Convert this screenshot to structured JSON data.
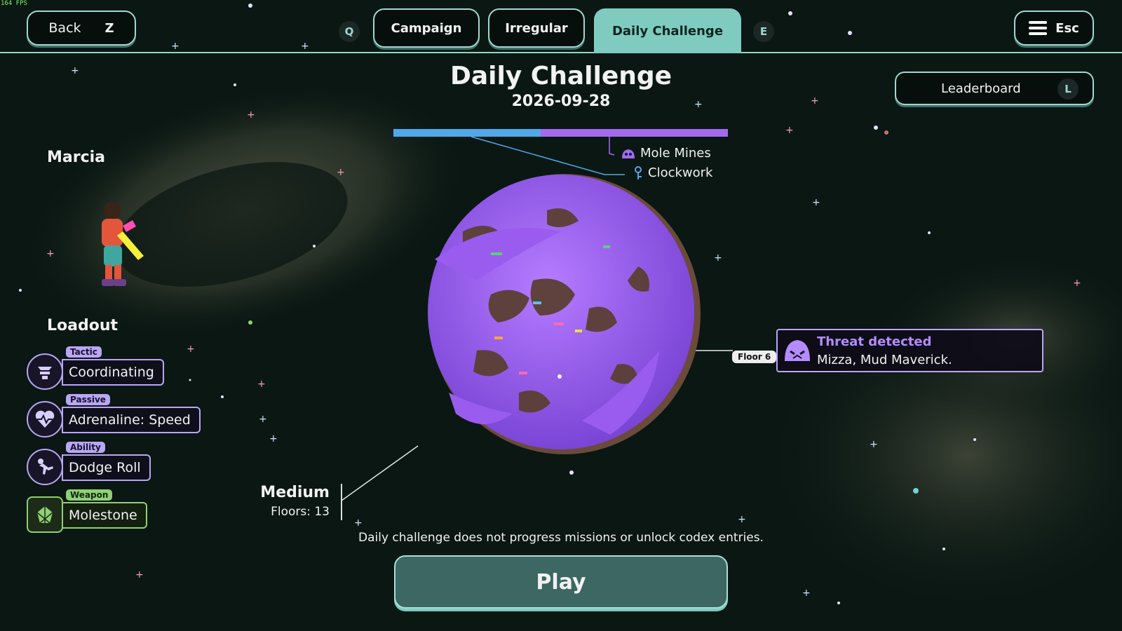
{
  "fps": "164 FPS",
  "header": {
    "back_label": "Back",
    "back_key": "Z",
    "prev_key": "Q",
    "next_key": "E",
    "tabs": [
      {
        "label": "Campaign",
        "active": false
      },
      {
        "label": "Irregular",
        "active": false
      },
      {
        "label": "Daily Challenge",
        "active": true
      }
    ],
    "menu_key": "Esc"
  },
  "leaderboard": {
    "label": "Leaderboard",
    "key": "L"
  },
  "title": "Daily Challenge",
  "date": "2026-09-28",
  "biomes": [
    {
      "name": "Mole Mines",
      "color": "#a36af0",
      "icon": "mole-icon"
    },
    {
      "name": "Clockwork",
      "color": "#4fa8ea",
      "icon": "clockwork-icon"
    }
  ],
  "character": {
    "name": "Marcia"
  },
  "loadout": {
    "title": "Loadout",
    "slots": [
      {
        "tag": "Tactic",
        "name": "Coordinating",
        "icon": "tactic-icon"
      },
      {
        "tag": "Passive",
        "name": "Adrenaline: Speed",
        "icon": "heart-pulse-icon"
      },
      {
        "tag": "Ability",
        "name": "Dodge Roll",
        "icon": "dodge-roll-icon"
      },
      {
        "tag": "Weapon",
        "name": "Molestone",
        "icon": "molestone-icon"
      }
    ]
  },
  "threat": {
    "floor": "Floor 6",
    "title": "Threat detected",
    "text": "Mizza, Mud Maverick.",
    "accent": "#b58cff"
  },
  "difficulty": {
    "level": "Medium",
    "floors": "Floors: 13"
  },
  "notice": "Daily challenge does not progress missions or unlock codex entries.",
  "play_label": "Play",
  "colors": {
    "accent": "#7fcbbf",
    "planet": "#9a5cef",
    "bg": "#08120f"
  }
}
